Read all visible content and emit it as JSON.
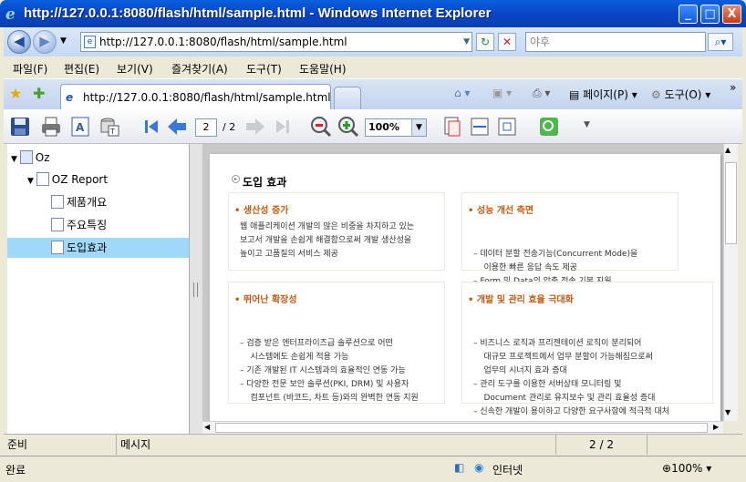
{
  "window": {
    "title": "http://127.0.0.1:8080/flash/html/sample.html - Windows Internet Explorer",
    "minimize": "_",
    "maximize": "□",
    "close": "X"
  },
  "address": {
    "url": "http://127.0.0.1:8080/flash/html/sample.html",
    "search_placeholder": "야후"
  },
  "menu": [
    "파일(F)",
    "편집(E)",
    "보기(V)",
    "즐겨찾기(A)",
    "도구(T)",
    "도움말(H)"
  ],
  "tab": {
    "label": "http://127.0.0.1:8080/flash/html/sample.html"
  },
  "commands": {
    "page": "페이지(P)",
    "tools": "도구(O)"
  },
  "viewer": {
    "page_current": "2",
    "page_total": "/ 2",
    "zoom": "100%"
  },
  "tree": {
    "root": "Oz",
    "report": "OZ Report",
    "items": [
      "제품개요",
      "주요특징",
      "도입효과"
    ],
    "selected": "도입효과"
  },
  "doc": {
    "section_title": "도입 효과",
    "boxes": [
      {
        "heading": "생산성 증가",
        "lines": [
          "웹 애플리케이션 개발의 많은 비중을 차지하고 있는",
          "보고서 개발을 손쉽게 해결함으로써 개발 생산성을",
          "높이고 고품질의 서비스 제공"
        ]
      },
      {
        "heading": "성능 개선 측면",
        "lines": [
          "– 데이터 분할 전송기능(Concurrent Mode)을",
          "    이용한 빠른 응답 속도 제공",
          "– Form 및 Data의 압축 전송 기본 지원"
        ]
      },
      {
        "heading": "뛰어난 확장성",
        "lines": [
          "– 검증 받은 엔터프라이즈급 솔루션으로 어떤",
          "    시스템에도 손쉽게 적용 가능",
          "– 기존 개발된 IT 시스템과의 효율적인 연동 가능",
          "– 다양한 전문 보안 솔루션(PKI, DRM) 및 사용자",
          "    컴포넌트 (바코드, 차트 등)와의 완벽한 연동 지원"
        ]
      },
      {
        "heading": "개발 및 관리 효율 극대화",
        "lines": [
          "– 비즈니스 로직과 프리젠테이션 로직이 분리되어",
          "    대규모 프로젝트에서 업무 분할이 가능해짐으로써",
          "    업무의 시너지 효과 증대",
          "– 관리 도구를 이용한 서버상태 모니터링 및",
          "    Document 관리로 유지보수 및 관리 효율성 증대",
          "– 신속한 개발이 용이하고 다양한 요구사항에 적극적 대처"
        ]
      }
    ]
  },
  "oz_status": {
    "ready": "준비",
    "message": "메시지",
    "page": "2 / 2"
  },
  "ie_status": {
    "done": "완료",
    "zone": "인터넷",
    "zoom": "100%"
  }
}
